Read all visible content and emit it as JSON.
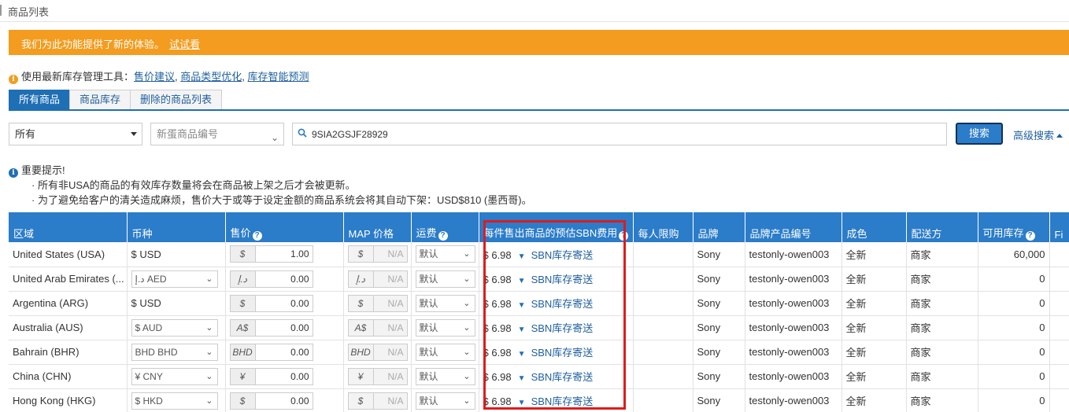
{
  "page": {
    "title": "商品列表"
  },
  "banner": {
    "message": "我们为此功能提供了新的体验。",
    "link": "试试看"
  },
  "tools": {
    "prefix": "使用最新库存管理工具：",
    "links": [
      "售价建议",
      "商品类型优化",
      "库存智能预测"
    ],
    "sep": ", "
  },
  "tabs": [
    "所有商品",
    "商品库存",
    "删除的商品列表"
  ],
  "filters": {
    "status_value": "所有",
    "sku_placeholder": "新蛋商品编号",
    "search_value": "9SIA2GSJF28929",
    "search_button": "搜索",
    "advanced": "高级搜索"
  },
  "notice": {
    "title": "重要提示!",
    "items": [
      "· 所有非USA的商品的有效库存数量将会在商品被上架之后才会被更新。",
      "· 为了避免给客户的清关造成麻烦，售价大于或等于设定金额的商品系统会将其自动下架：USD$810 (墨西哥)。"
    ]
  },
  "table": {
    "headers": {
      "region": "区域",
      "currency": "币种",
      "price": "售价",
      "map": "MAP 价格",
      "shipping": "运费",
      "fee": "每件售出商品的预估SBN费用",
      "limit": "每人限购",
      "brand": "品牌",
      "mfr": "品牌产品编号",
      "condition": "成色",
      "fulfill": "配送方",
      "stock": "可用库存",
      "more": "Fi"
    },
    "rows": [
      {
        "region": "United States (USA)",
        "currency": "$ USD",
        "cur_dd": false,
        "sym": "$",
        "price": "1.00",
        "map_sym": "$",
        "map": "N/A",
        "shipping": "默认",
        "fee": "$ 6.98",
        "method": "SBN库存寄送",
        "limit": "",
        "brand": "Sony",
        "mfr": "testonly-owen003",
        "condition": "全新",
        "fulfill": "商家",
        "stock": "60,000"
      },
      {
        "region": "United Arab Emirates (...",
        "currency": "د.إ AED",
        "cur_dd": true,
        "sym": "د.إ",
        "price": "0.00",
        "map_sym": "د.إ",
        "map": "N/A",
        "shipping": "默认",
        "fee": "$ 6.98",
        "method": "SBN库存寄送",
        "limit": "",
        "brand": "Sony",
        "mfr": "testonly-owen003",
        "condition": "全新",
        "fulfill": "商家",
        "stock": "0"
      },
      {
        "region": "Argentina (ARG)",
        "currency": "$ USD",
        "cur_dd": false,
        "sym": "$",
        "price": "0.00",
        "map_sym": "$",
        "map": "N/A",
        "shipping": "默认",
        "fee": "$ 6.98",
        "method": "SBN库存寄送",
        "limit": "",
        "brand": "Sony",
        "mfr": "testonly-owen003",
        "condition": "全新",
        "fulfill": "商家",
        "stock": "0"
      },
      {
        "region": "Australia (AUS)",
        "currency": "$ AUD",
        "cur_dd": true,
        "sym": "A$",
        "price": "0.00",
        "map_sym": "A$",
        "map": "N/A",
        "shipping": "默认",
        "fee": "$ 6.98",
        "method": "SBN库存寄送",
        "limit": "",
        "brand": "Sony",
        "mfr": "testonly-owen003",
        "condition": "全新",
        "fulfill": "商家",
        "stock": "0"
      },
      {
        "region": "Bahrain (BHR)",
        "currency": "BHD BHD",
        "cur_dd": true,
        "sym": "BHD",
        "price": "0.00",
        "map_sym": "BHD",
        "map": "N/A",
        "shipping": "默认",
        "fee": "$ 6.98",
        "method": "SBN库存寄送",
        "limit": "",
        "brand": "Sony",
        "mfr": "testonly-owen003",
        "condition": "全新",
        "fulfill": "商家",
        "stock": "0"
      },
      {
        "region": "China (CHN)",
        "currency": "¥ CNY",
        "cur_dd": true,
        "sym": "¥",
        "price": "0.00",
        "map_sym": "¥",
        "map": "N/A",
        "shipping": "默认",
        "fee": "$ 6.98",
        "method": "SBN库存寄送",
        "limit": "",
        "brand": "Sony",
        "mfr": "testonly-owen003",
        "condition": "全新",
        "fulfill": "商家",
        "stock": "0"
      },
      {
        "region": "Hong Kong (HKG)",
        "currency": "$ HKD",
        "cur_dd": true,
        "sym": "$",
        "price": "0.00",
        "map_sym": "$",
        "map": "N/A",
        "shipping": "默认",
        "fee": "$ 6.98",
        "method": "SBN库存寄送",
        "limit": "",
        "brand": "Sony",
        "mfr": "testonly-owen003",
        "condition": "全新",
        "fulfill": "商家",
        "stock": "0"
      }
    ]
  },
  "icons": {
    "info": "info-icon",
    "help": "help-icon",
    "search": "search-icon",
    "chevron": "chevron-down-icon"
  },
  "colors": {
    "header_blue": "#2b7cc9",
    "banner_orange": "#f39c1f",
    "highlight_red": "#e01b1b",
    "link_blue": "#1f5f9f"
  }
}
